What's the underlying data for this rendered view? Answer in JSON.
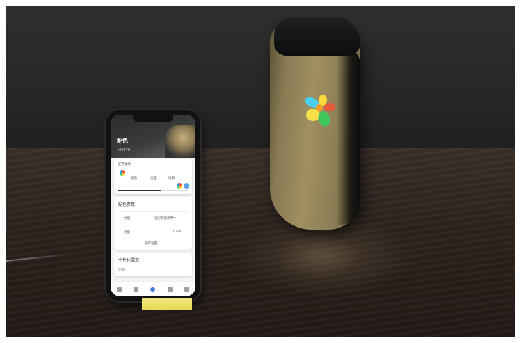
{
  "scene": {
    "description_colors": {
      "wall": "#262626",
      "table": "#2c221d",
      "device_body": "#a08f62",
      "device_cap": "#0c0d0e",
      "stand": "#e6d84a"
    }
  },
  "phone": {
    "app_title": "配色",
    "id_text": "100070",
    "card1": {
      "label": "配方编号",
      "col1": "颜色",
      "col2": "亮度",
      "col3": "饱和"
    },
    "card2": {
      "title": "配色参数",
      "row1_label": "色相",
      "row1_value": "全彩色盘调节中",
      "row2_label": "亮度",
      "row2_value": "100%",
      "button": "保存设置"
    },
    "card3": {
      "title": "个性化需求",
      "sub": "定制"
    },
    "progress": 0.62
  },
  "device": {
    "logo_icon": "flower-logo-icon"
  }
}
